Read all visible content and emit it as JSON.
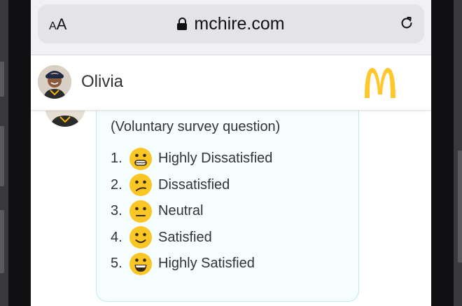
{
  "browser": {
    "aa_small": "A",
    "aa_large": "A",
    "url": "mchire.com"
  },
  "chat": {
    "agent_name": "Olivia",
    "question_note": "(Voluntary survey question)",
    "options": [
      {
        "number": "1.",
        "label": "Highly Dissatisfied",
        "icon": "grimacing-face-icon"
      },
      {
        "number": "2.",
        "label": "Dissatisfied",
        "icon": "confused-face-icon"
      },
      {
        "number": "3.",
        "label": "Neutral",
        "icon": "neutral-face-icon"
      },
      {
        "number": "4.",
        "label": "Satisfied",
        "icon": "slightly-smiling-face-icon"
      },
      {
        "number": "5.",
        "label": "Highly Satisfied",
        "icon": "grinning-face-icon"
      }
    ]
  },
  "colors": {
    "logo_yellow": "#FFC72C",
    "bubble_border": "#BFEAEC",
    "emoji_yellow": "#F9C623"
  }
}
